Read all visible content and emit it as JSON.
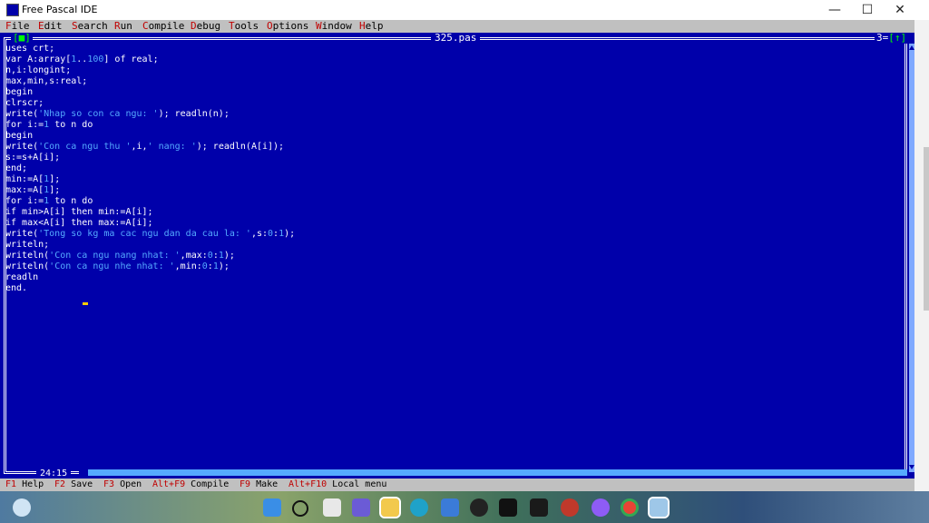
{
  "window": {
    "title": "Free Pascal IDE",
    "minimize_glyph": "—",
    "maximize_glyph": "☐",
    "close_glyph": "✕"
  },
  "menu": {
    "items": [
      {
        "hot": "F",
        "rest": "ile"
      },
      {
        "hot": "E",
        "rest": "dit"
      },
      {
        "hot": "S",
        "rest": "earch"
      },
      {
        "hot": "R",
        "rest": "un"
      },
      {
        "hot": "C",
        "rest": "ompile"
      },
      {
        "hot": "D",
        "rest": "ebug"
      },
      {
        "hot": "T",
        "rest": "ools"
      },
      {
        "hot": "O",
        "rest": "ptions"
      },
      {
        "hot": "W",
        "rest": "indow"
      },
      {
        "hot": "H",
        "rest": "elp"
      }
    ]
  },
  "editor": {
    "filename": "325.pas",
    "close_box": "[■]",
    "window_number": "3=",
    "zoom_box": "[↑]",
    "cursor_position": "24:15",
    "colors": {
      "background": "#0000aa",
      "text": "#ffffff",
      "literal": "#55aaff"
    },
    "lines": [
      "uses crt;",
      "var A:array[1..100] of real;",
      "n,i:longint;",
      "max,min,s:real;",
      "begin",
      "clrscr;",
      "write('Nhap so con ca ngu: '); readln(n);",
      "for i:=1 to n do",
      "begin",
      "write('Con ca ngu thu ',i,' nang: '); readln(A[i]);",
      "s:=s+A[i];",
      "end;",
      "min:=A[1];",
      "max:=A[1];",
      "for i:=1 to n do",
      "if min>A[i] then min:=A[i];",
      "if max<A[i] then max:=A[i];",
      "write('Tong so kg ma cac ngu dan da cau la: ',s:0:1);",
      "writeln;",
      "writeln('Con ca ngu nang nhat: ',max:0:1);",
      "writeln('Con ca ngu nhe nhat: ',min:0:1);",
      "readln",
      "end."
    ]
  },
  "status": {
    "items": [
      {
        "key": "F1",
        "label": " Help"
      },
      {
        "key": "F2",
        "label": " Save"
      },
      {
        "key": "F3",
        "label": " Open"
      },
      {
        "key": "Alt+F9",
        "label": " Compile"
      },
      {
        "key": "F9",
        "label": " Make"
      },
      {
        "key": "Alt+F10",
        "label": " Local menu"
      }
    ]
  },
  "taskbar": {
    "icons": [
      "weather-icon",
      "start-icon",
      "search-icon",
      "task-view-icon",
      "chat-icon",
      "file-explorer-icon",
      "edge-icon",
      "store-icon",
      "obs-icon",
      "tiktok-icon",
      "capcut-icon",
      "davinci-icon",
      "messenger-icon",
      "chrome-icon",
      "free-pascal-icon"
    ],
    "accent": "#0078d4"
  }
}
